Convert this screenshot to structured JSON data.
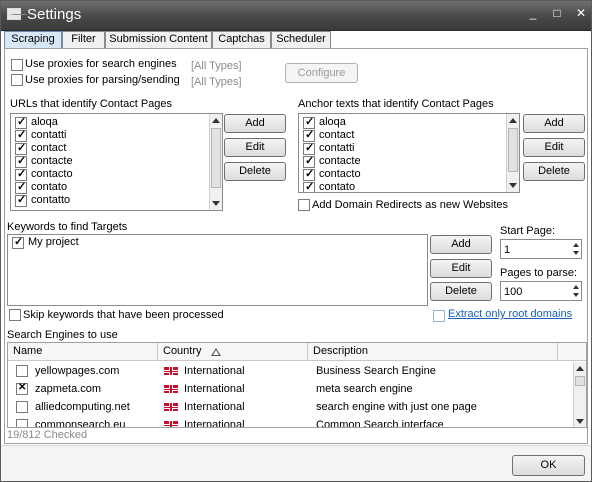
{
  "window": {
    "title": "Settings",
    "controls": {
      "minimize": "_",
      "maximize": "□",
      "close": "✕"
    }
  },
  "tabs": [
    {
      "label": "Scraping",
      "active": true
    },
    {
      "label": "Filter"
    },
    {
      "label": "Submission Content"
    },
    {
      "label": "Captchas"
    },
    {
      "label": "Scheduler"
    }
  ],
  "proxies": {
    "search_label": "Use proxies for search engines",
    "search_types": "[All Types]",
    "parsing_label": "Use proxies for parsing/sending",
    "parsing_types": "[All Types]",
    "configure_button": "Configure"
  },
  "urls": {
    "heading": "URLs that identify Contact Pages",
    "items": [
      "aloqa",
      "contatti",
      "contact",
      "contacte",
      "contacto",
      "contato",
      "contatto"
    ],
    "add_button": "Add",
    "edit_button": "Edit",
    "delete_button": "Delete"
  },
  "anchors": {
    "heading": "Anchor texts that identify Contact Pages",
    "items": [
      "aloqa",
      "contact",
      "contatti",
      "contacte",
      "contacto",
      "contato"
    ],
    "add_button": "Add",
    "edit_button": "Edit",
    "delete_button": "Delete",
    "redirects_label": "Add Domain Redirects as new Websites"
  },
  "keywords": {
    "heading": "Keywords to find Targets",
    "items": [
      "My project"
    ],
    "add_button": "Add",
    "edit_button": "Edit",
    "delete_button": "Delete",
    "skip_label": "Skip keywords that have been processed"
  },
  "pages": {
    "start_label": "Start Page:",
    "start_value": "1",
    "parse_label": "Pages to parse:",
    "parse_value": "100",
    "root_domains_link": "Extract only root domains"
  },
  "engines": {
    "heading": "Search Engines to use",
    "columns": [
      "Name",
      "Country",
      "Description"
    ],
    "rows": [
      {
        "name": "yellowpages.com",
        "country": "International",
        "description": "Business Search Engine",
        "checked": false
      },
      {
        "name": "zapmeta.com",
        "country": "International",
        "description": "meta search engine",
        "checked": true
      },
      {
        "name": "alliedcomputing.net",
        "country": "International",
        "description": "search engine with just one page",
        "checked": false
      },
      {
        "name": "commonsearch.eu",
        "country": "International",
        "description": "Common Search interface",
        "checked": false
      }
    ],
    "status": "19/812 Checked"
  },
  "ok_button": "OK",
  "colors": {
    "title_bar": "#4a4a4a",
    "active_tab": "#d7e7f7",
    "link": "#1a5fb4"
  },
  "icons": {
    "window": "settings-window-icon",
    "sort": "sort-ascending-icon",
    "flag": "uk-flag-icon"
  }
}
